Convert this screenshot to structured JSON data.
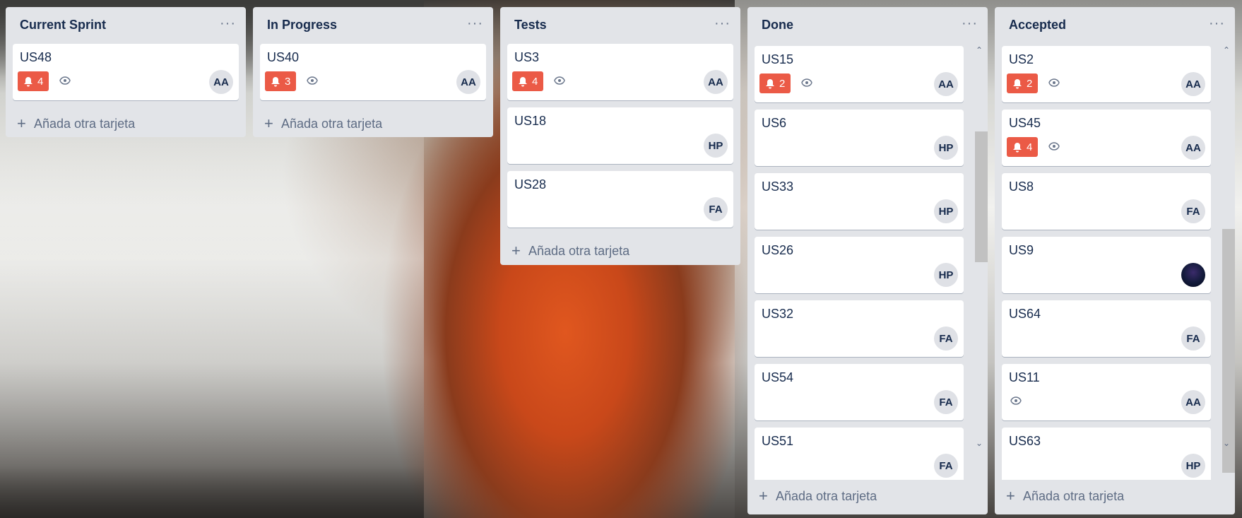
{
  "add_card_label": "Añada otra tarjeta",
  "menu_glyph": "···",
  "colors": {
    "alert": "#eb5a46",
    "list_bg": "#e2e4e8"
  },
  "lists": [
    {
      "title": "Current Sprint",
      "cards": [
        {
          "title": "US48",
          "alerts": "4",
          "watch": true,
          "member": "AA"
        }
      ]
    },
    {
      "title": "In Progress",
      "cards": [
        {
          "title": "US40",
          "alerts": "3",
          "watch": true,
          "member": "AA"
        }
      ]
    },
    {
      "title": "Tests",
      "cards": [
        {
          "title": "US3",
          "alerts": "4",
          "watch": true,
          "member": "AA"
        },
        {
          "title": "US18",
          "member": "HP"
        },
        {
          "title": "US28",
          "member": "FA"
        }
      ]
    },
    {
      "title": "Done",
      "cards": [
        {
          "title": "US15",
          "alerts": "2",
          "watch": true,
          "member": "AA"
        },
        {
          "title": "US6",
          "member": "HP"
        },
        {
          "title": "US33",
          "member": "HP"
        },
        {
          "title": "US26",
          "member": "HP"
        },
        {
          "title": "US32",
          "member": "FA"
        },
        {
          "title": "US54",
          "member": "FA"
        },
        {
          "title": "US51",
          "member": "FA"
        }
      ]
    },
    {
      "title": "Accepted",
      "cards": [
        {
          "title": "US2",
          "alerts": "2",
          "watch": true,
          "member": "AA"
        },
        {
          "title": "US45",
          "alerts": "4",
          "watch": true,
          "member": "AA"
        },
        {
          "title": "US8",
          "member": "FA"
        },
        {
          "title": "US9",
          "member_photo": true
        },
        {
          "title": "US64",
          "member": "FA"
        },
        {
          "title": "US11",
          "watch": true,
          "member": "AA"
        },
        {
          "title": "US63",
          "member": "HP"
        }
      ]
    }
  ]
}
